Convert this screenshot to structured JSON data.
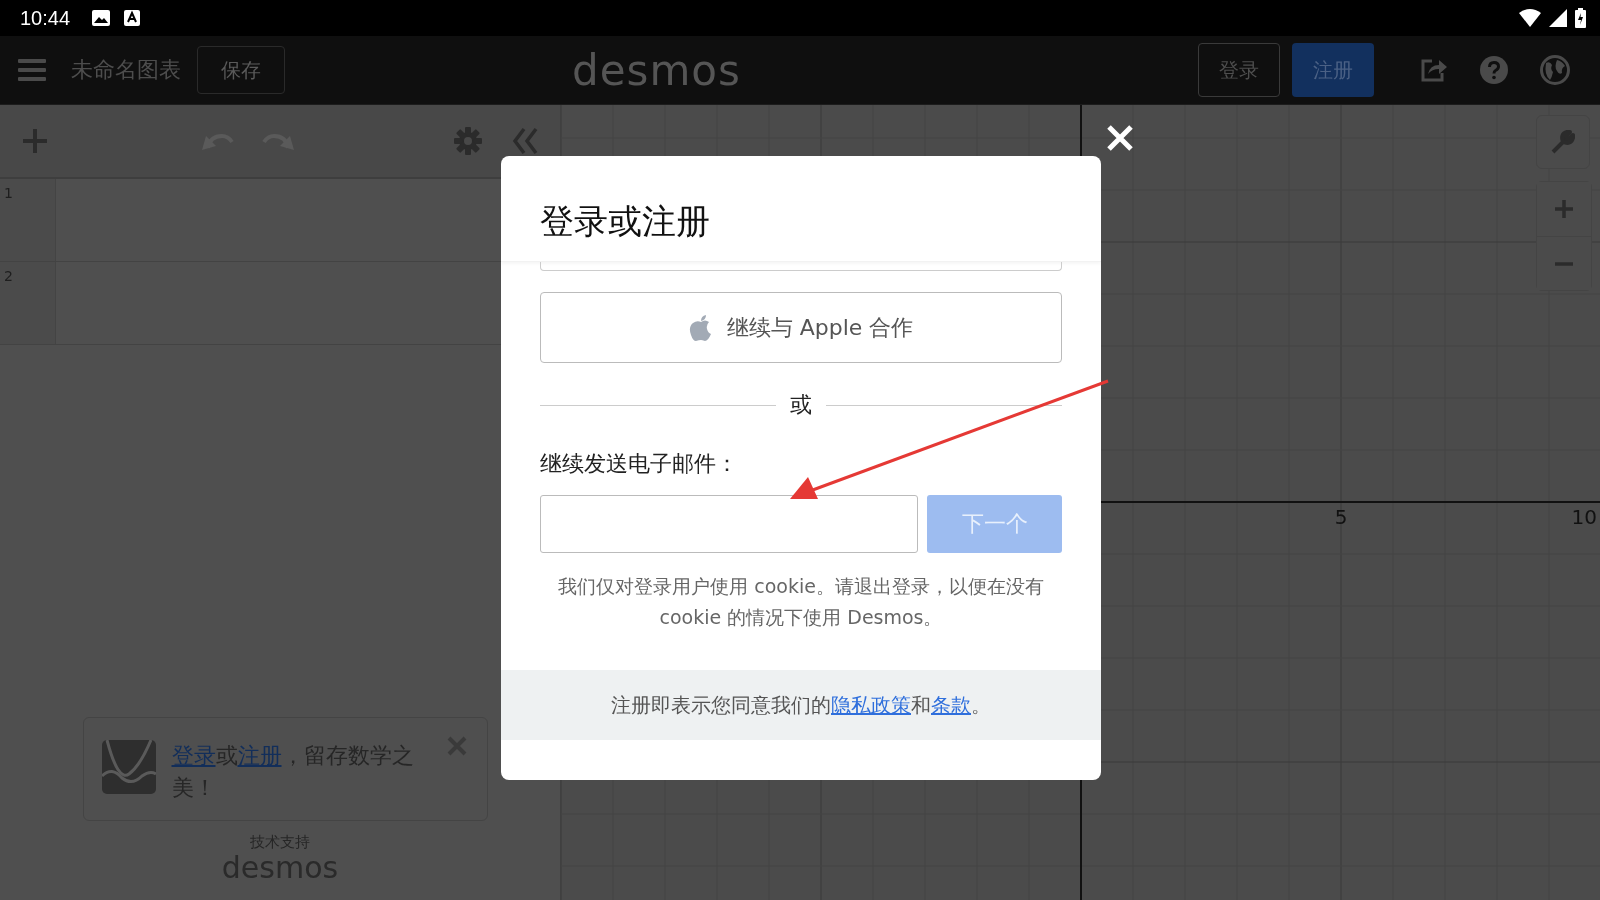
{
  "status_bar": {
    "time": "10:44"
  },
  "header": {
    "graph_title": "未命名图表",
    "save_button": {
      "label": "保存",
      "disabled": true
    },
    "logo": "desmos",
    "login_button": "登录",
    "signup_button": "注册"
  },
  "toolbar": {
    "undo": {
      "disabled": true
    },
    "redo": {
      "disabled": true
    }
  },
  "expression_rows": [
    "1",
    "2"
  ],
  "graph": {
    "x_axis_labels": [
      "5",
      "10"
    ]
  },
  "dialog": {
    "title": "登录或注册",
    "apple_button": "继续与 Apple 合作",
    "divider_text": "或",
    "email_label": "继续发送电子邮件：",
    "next_button": {
      "label": "下一个",
      "disabled": true
    },
    "cookie_notice": "我们仅对登录用户使用 cookie。请退出登录，以便在没有 cookie 的情况下使用 Desmos。",
    "footer_parts": [
      {
        "text": "注册即表示您同意我们的",
        "link": false
      },
      {
        "text": "隐私政策",
        "link": true
      },
      {
        "text": "和",
        "link": false
      },
      {
        "text": "条款",
        "link": true
      },
      {
        "text": "。",
        "link": false
      }
    ]
  },
  "promo": {
    "parts": [
      {
        "text": "登录",
        "link": true
      },
      {
        "text": "或",
        "link": false
      },
      {
        "text": "注册",
        "link": true
      },
      {
        "text": "，留存数学之美！",
        "link": false
      }
    ]
  },
  "powered_by": {
    "caption": "技术支持",
    "logo": "desmos"
  }
}
